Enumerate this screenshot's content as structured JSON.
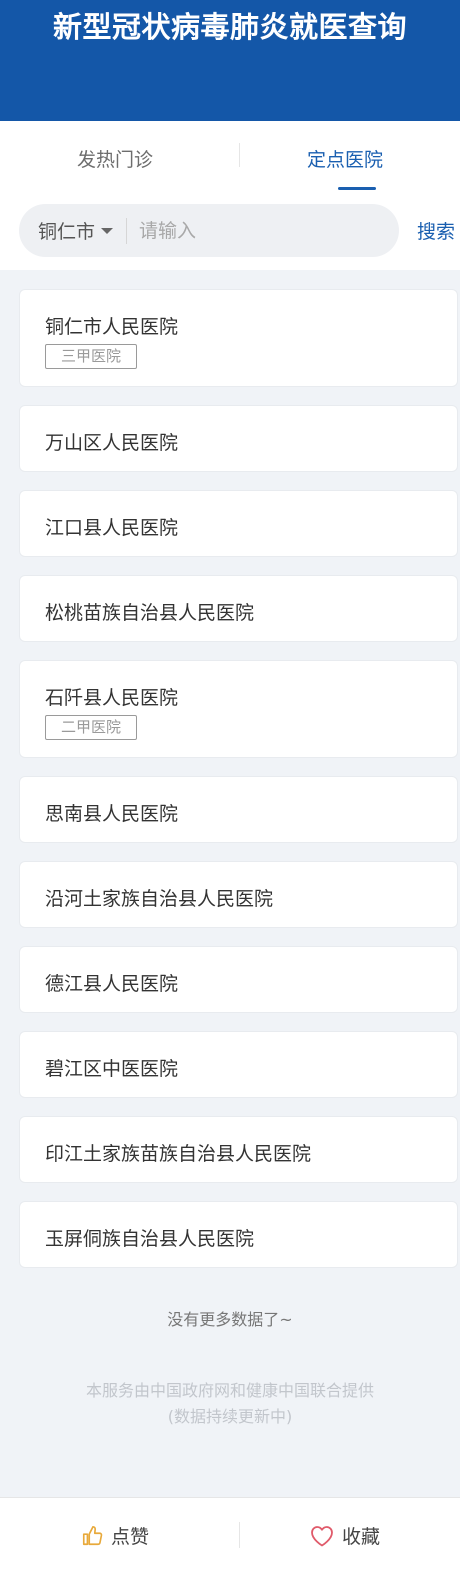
{
  "header": {
    "title": "新型冠状病毒肺炎就医查询"
  },
  "tabs": [
    {
      "label": "发热门诊",
      "active": false
    },
    {
      "label": "定点医院",
      "active": true
    }
  ],
  "search": {
    "city": "铜仁市",
    "placeholder": "请输入",
    "value": "",
    "button_label": "搜索"
  },
  "hospitals": [
    {
      "name": "铜仁市人民医院",
      "tag": "三甲医院"
    },
    {
      "name": "万山区人民医院"
    },
    {
      "name": "江口县人民医院"
    },
    {
      "name": "松桃苗族自治县人民医院"
    },
    {
      "name": "石阡县人民医院",
      "tag": "二甲医院"
    },
    {
      "name": "思南县人民医院"
    },
    {
      "name": "沿河土家族自治县人民医院"
    },
    {
      "name": "德江县人民医院"
    },
    {
      "name": "碧江区中医医院"
    },
    {
      "name": "印江土家族苗族自治县人民医院"
    },
    {
      "name": "玉屏侗族自治县人民医院"
    }
  ],
  "list_end_text": "没有更多数据了~",
  "footer_note": {
    "line1": "本服务由中国政府网和健康中国联合提供",
    "line2": "(数据持续更新中)"
  },
  "bottom_bar": {
    "like_label": "点赞",
    "favorite_label": "收藏"
  },
  "colors": {
    "brand": "#1457a8",
    "accent": "#1a5fb0",
    "like_icon": "#e8a93a",
    "favorite_icon": "#e05a6a"
  }
}
